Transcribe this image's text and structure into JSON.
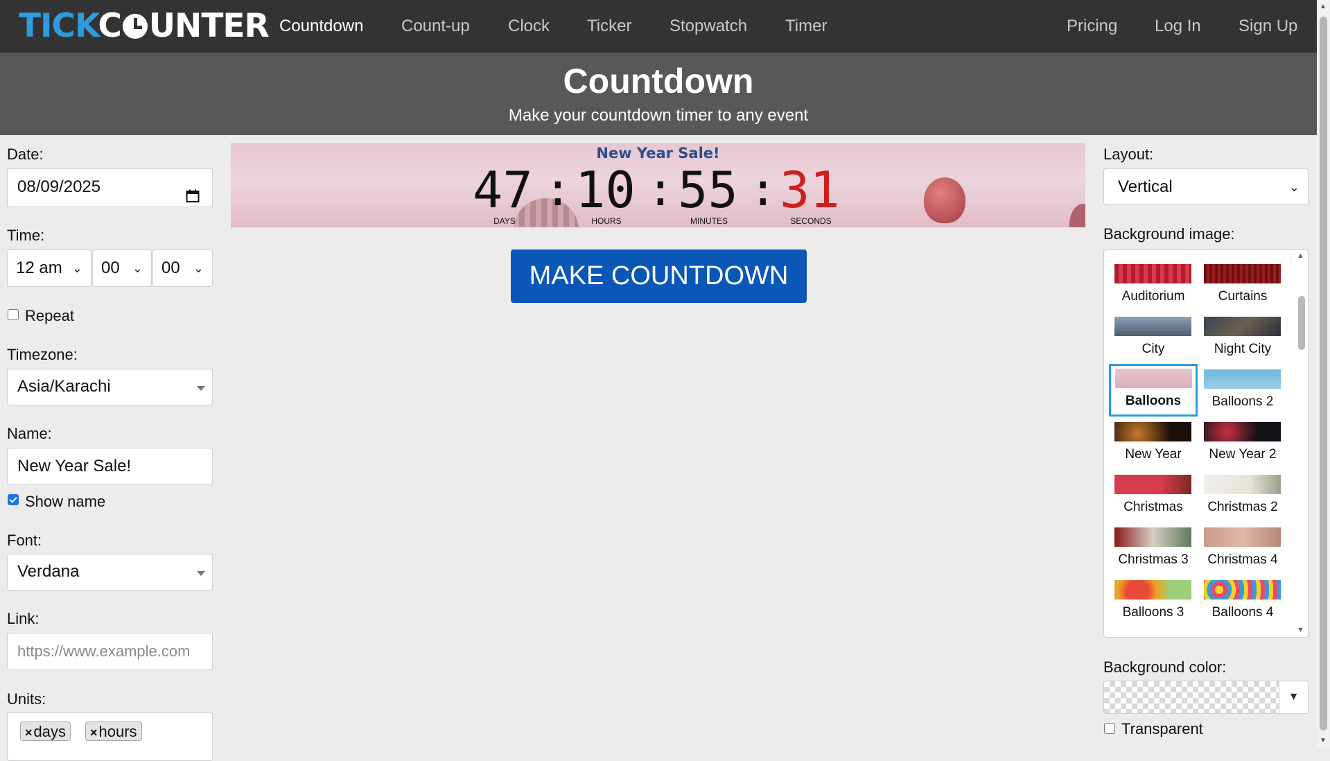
{
  "header": {
    "logo_text": "TICKCOUNTER",
    "nav": [
      "Countdown",
      "Count-up",
      "Clock",
      "Ticker",
      "Stopwatch",
      "Timer"
    ],
    "active_nav": "Countdown",
    "right_nav": [
      "Pricing",
      "Log In",
      "Sign Up"
    ]
  },
  "hero": {
    "title": "Countdown",
    "subtitle": "Make your countdown timer to any event"
  },
  "form": {
    "date_label": "Date:",
    "date_value": "08/09/2025",
    "time_label": "Time:",
    "time_hour": "12 am",
    "time_minute": "00",
    "time_second": "00",
    "repeat_label": "Repeat",
    "repeat_checked": false,
    "timezone_label": "Timezone:",
    "timezone_value": "Asia/Karachi",
    "name_label": "Name:",
    "name_value": "New Year Sale!",
    "show_name_label": "Show name",
    "show_name_checked": true,
    "font_label": "Font:",
    "font_value": "Verdana",
    "link_label": "Link:",
    "link_placeholder": "https://www.example.com",
    "units_label": "Units:",
    "units": [
      "days",
      "hours"
    ]
  },
  "preview": {
    "name": "New Year Sale!",
    "days": "47",
    "hours": "10",
    "minutes": "55",
    "seconds": "31",
    "separator": ":",
    "labels": {
      "days": "DAYS",
      "hours": "HOURS",
      "minutes": "MINUTES",
      "seconds": "SECONDS"
    },
    "seconds_color": "#d01e1e"
  },
  "make_button": "MAKE COUNTDOWN",
  "settings": {
    "layout_label": "Layout:",
    "layout_value": "Vertical",
    "bg_image_label": "Background image:",
    "images": [
      {
        "name": "Auditorium",
        "selected": false
      },
      {
        "name": "Curtains",
        "selected": false
      },
      {
        "name": "City",
        "selected": false
      },
      {
        "name": "Night City",
        "selected": false
      },
      {
        "name": "Balloons",
        "selected": true
      },
      {
        "name": "Balloons 2",
        "selected": false
      },
      {
        "name": "New Year",
        "selected": false
      },
      {
        "name": "New Year 2",
        "selected": false
      },
      {
        "name": "Christmas",
        "selected": false
      },
      {
        "name": "Christmas 2",
        "selected": false
      },
      {
        "name": "Christmas 3",
        "selected": false
      },
      {
        "name": "Christmas 4",
        "selected": false
      },
      {
        "name": "Balloons 3",
        "selected": false
      },
      {
        "name": "Balloons 4",
        "selected": false
      }
    ],
    "bg_color_label": "Background color:",
    "transparent_label": "Transparent",
    "transparent_checked": false
  },
  "colors": {
    "header_bg": "#333333",
    "hero_bg": "#585858",
    "accent": "#0a57b8",
    "selected_border": "#2e9bdc",
    "logo_accent": "#2e9bdc"
  }
}
